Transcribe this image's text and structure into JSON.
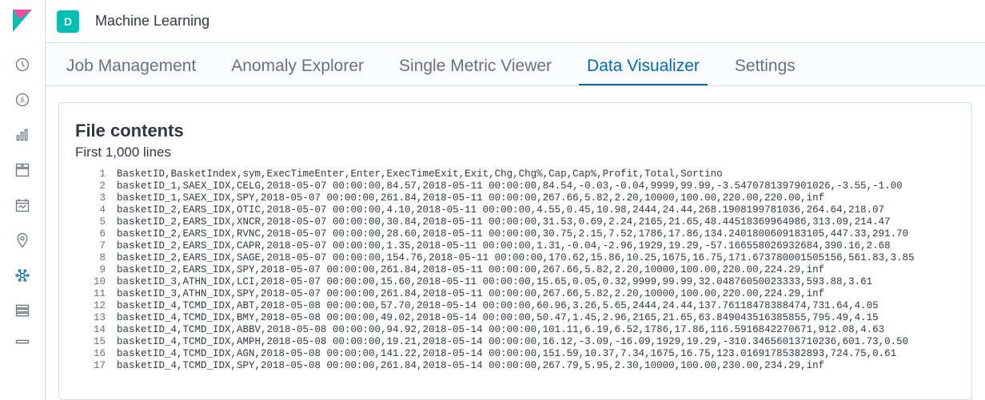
{
  "header": {
    "space_letter": "D",
    "app_title": "Machine Learning"
  },
  "tabs": [
    {
      "id": "job-management",
      "label": "Job Management",
      "active": false
    },
    {
      "id": "anomaly-explorer",
      "label": "Anomaly Explorer",
      "active": false
    },
    {
      "id": "single-metric-viewer",
      "label": "Single Metric Viewer",
      "active": false
    },
    {
      "id": "data-visualizer",
      "label": "Data Visualizer",
      "active": true
    },
    {
      "id": "settings",
      "label": "Settings",
      "active": false
    }
  ],
  "panel": {
    "title": "File contents",
    "subtitle": "First 1,000 lines"
  },
  "file_lines": [
    "BasketID,BasketIndex,sym,ExecTimeEnter,Enter,ExecTimeExit,Exit,Chg,Chg%,Cap,Cap%,Profit,Total,Sortino",
    "basketID_1,SAEX_IDX,CELG,2018-05-07 00:00:00,84.57,2018-05-11 00:00:00,84.54,-0.03,-0.04,9999,99.99,-3.5470781397901026,-3.55,-1.00",
    "basketID_1,SAEX_IDX,SPY,2018-05-07 00:00:00,261.84,2018-05-11 00:00:00,267.66,5.82,2.20,10000,100.00,220.00,220.00,inf",
    "basketID_2,EARS_IDX,OTIC,2018-05-07 00:00:00,4.10,2018-05-11 00:00:00,4.55,0.45,10.98,2444,24.44,268.1908199781036,264.64,218.07",
    "basketID_2,EARS_IDX,XNCR,2018-05-07 00:00:00,30.84,2018-05-11 00:00:00,31.53,0.69,2.24,2165,21.65,48.44518369964986,313.09,214.47",
    "basketID_2,EARS_IDX,RVNC,2018-05-07 00:00:00,28.60,2018-05-11 00:00:00,30.75,2.15,7.52,1786,17.86,134.2401800609183105,447.33,291.70",
    "basketID_2,EARS_IDX,CAPR,2018-05-07 00:00:00,1.35,2018-05-11 00:00:00,1.31,-0.04,-2.96,1929,19.29,-57.166558026932684,390.16,2.68",
    "basketID_2,EARS_IDX,SAGE,2018-05-07 00:00:00,154.76,2018-05-11 00:00:00,170.62,15.86,10.25,1675,16.75,171.673780001505156,561.83,3.85",
    "basketID_2,EARS_IDX,SPY,2018-05-07 00:00:00,261.84,2018-05-11 00:00:00,267.66,5.82,2.20,10000,100.00,220.00,224.29,inf",
    "basketID_3,ATHN_IDX,LCI,2018-05-07 00:00:00,15.60,2018-05-11 00:00:00,15.65,0.05,0.32,9999,99.99,32.04876050023333,593.88,3.61",
    "basketID_3,ATHN_IDX,SPY,2018-05-07 00:00:00,261.84,2018-05-11 00:00:00,267.66,5.82,2.20,10000,100.00,220.00,224.29,inf",
    "basketID_4,TCMD_IDX,ABT,2018-05-08 00:00:00,57.70,2018-05-14 00:00:00,60.96,3.26,5.65,2444,24.44,137.76118478388474,731.64,4.05",
    "basketID_4,TCMD_IDX,BMY,2018-05-08 00:00:00,49.02,2018-05-14 00:00:00,50.47,1.45,2.96,2165,21.65,63.849043516385855,795.49,4.15",
    "basketID_4,TCMD_IDX,ABBV,2018-05-08 00:00:00,94.92,2018-05-14 00:00:00,101.11,6.19,6.52,1786,17.86,116.5916842270671,912.08,4.63",
    "basketID_4,TCMD_IDX,AMPH,2018-05-08 00:00:00,19.21,2018-05-14 00:00:00,16.12,-3.09,-16.09,1929,19.29,-310.34656013710236,601.73,0.50",
    "basketID_4,TCMD_IDX,AGN,2018-05-08 00:00:00,141.22,2018-05-14 00:00:00,151.59,10.37,7.34,1675,16.75,123.01691785382893,724.75,0.61",
    "basketID_4,TCMD_IDX,SPY,2018-05-08 00:00:00,261.84,2018-05-14 00:00:00,267.79,5.95,2.30,10000,100.00,230.00,234.29,inf"
  ]
}
